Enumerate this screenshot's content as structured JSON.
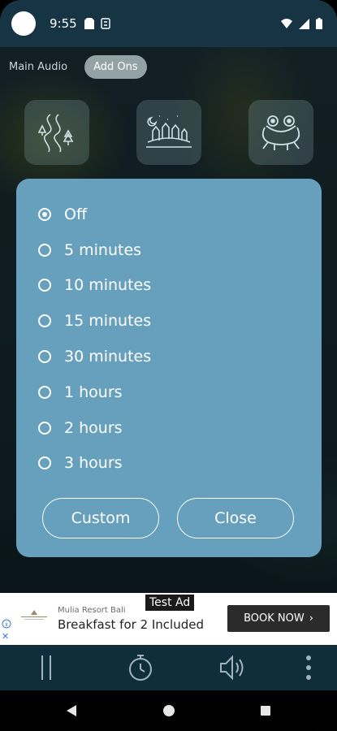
{
  "status_bar": {
    "time": "9:55"
  },
  "tabs": [
    {
      "label": "Main Audio",
      "active": false
    },
    {
      "label": "Add Ons",
      "active": true
    }
  ],
  "sound_tiles": [
    {
      "icon": "forest-path-icon"
    },
    {
      "icon": "night-village-icon"
    },
    {
      "icon": "frog-icon"
    }
  ],
  "timer_dialog": {
    "options": [
      {
        "label": "Off",
        "selected": true
      },
      {
        "label": "5 minutes",
        "selected": false
      },
      {
        "label": "10 minutes",
        "selected": false
      },
      {
        "label": "15 minutes",
        "selected": false
      },
      {
        "label": "30 minutes",
        "selected": false
      },
      {
        "label": "1 hours",
        "selected": false
      },
      {
        "label": "2 hours",
        "selected": false
      },
      {
        "label": "3 hours",
        "selected": false
      }
    ],
    "custom_label": "Custom",
    "close_label": "Close"
  },
  "ad": {
    "tag": "Test Ad",
    "advertiser": "Mulia Resort Bali",
    "headline": "Breakfast for 2 Included",
    "cta": "BOOK NOW"
  },
  "controls": [
    "pause-icon",
    "timer-icon",
    "volume-icon",
    "more-vert-icon"
  ],
  "colors": {
    "dialog": "#67a0bd",
    "status_bar": "#163443",
    "controls_bar": "#0f2d3b"
  }
}
